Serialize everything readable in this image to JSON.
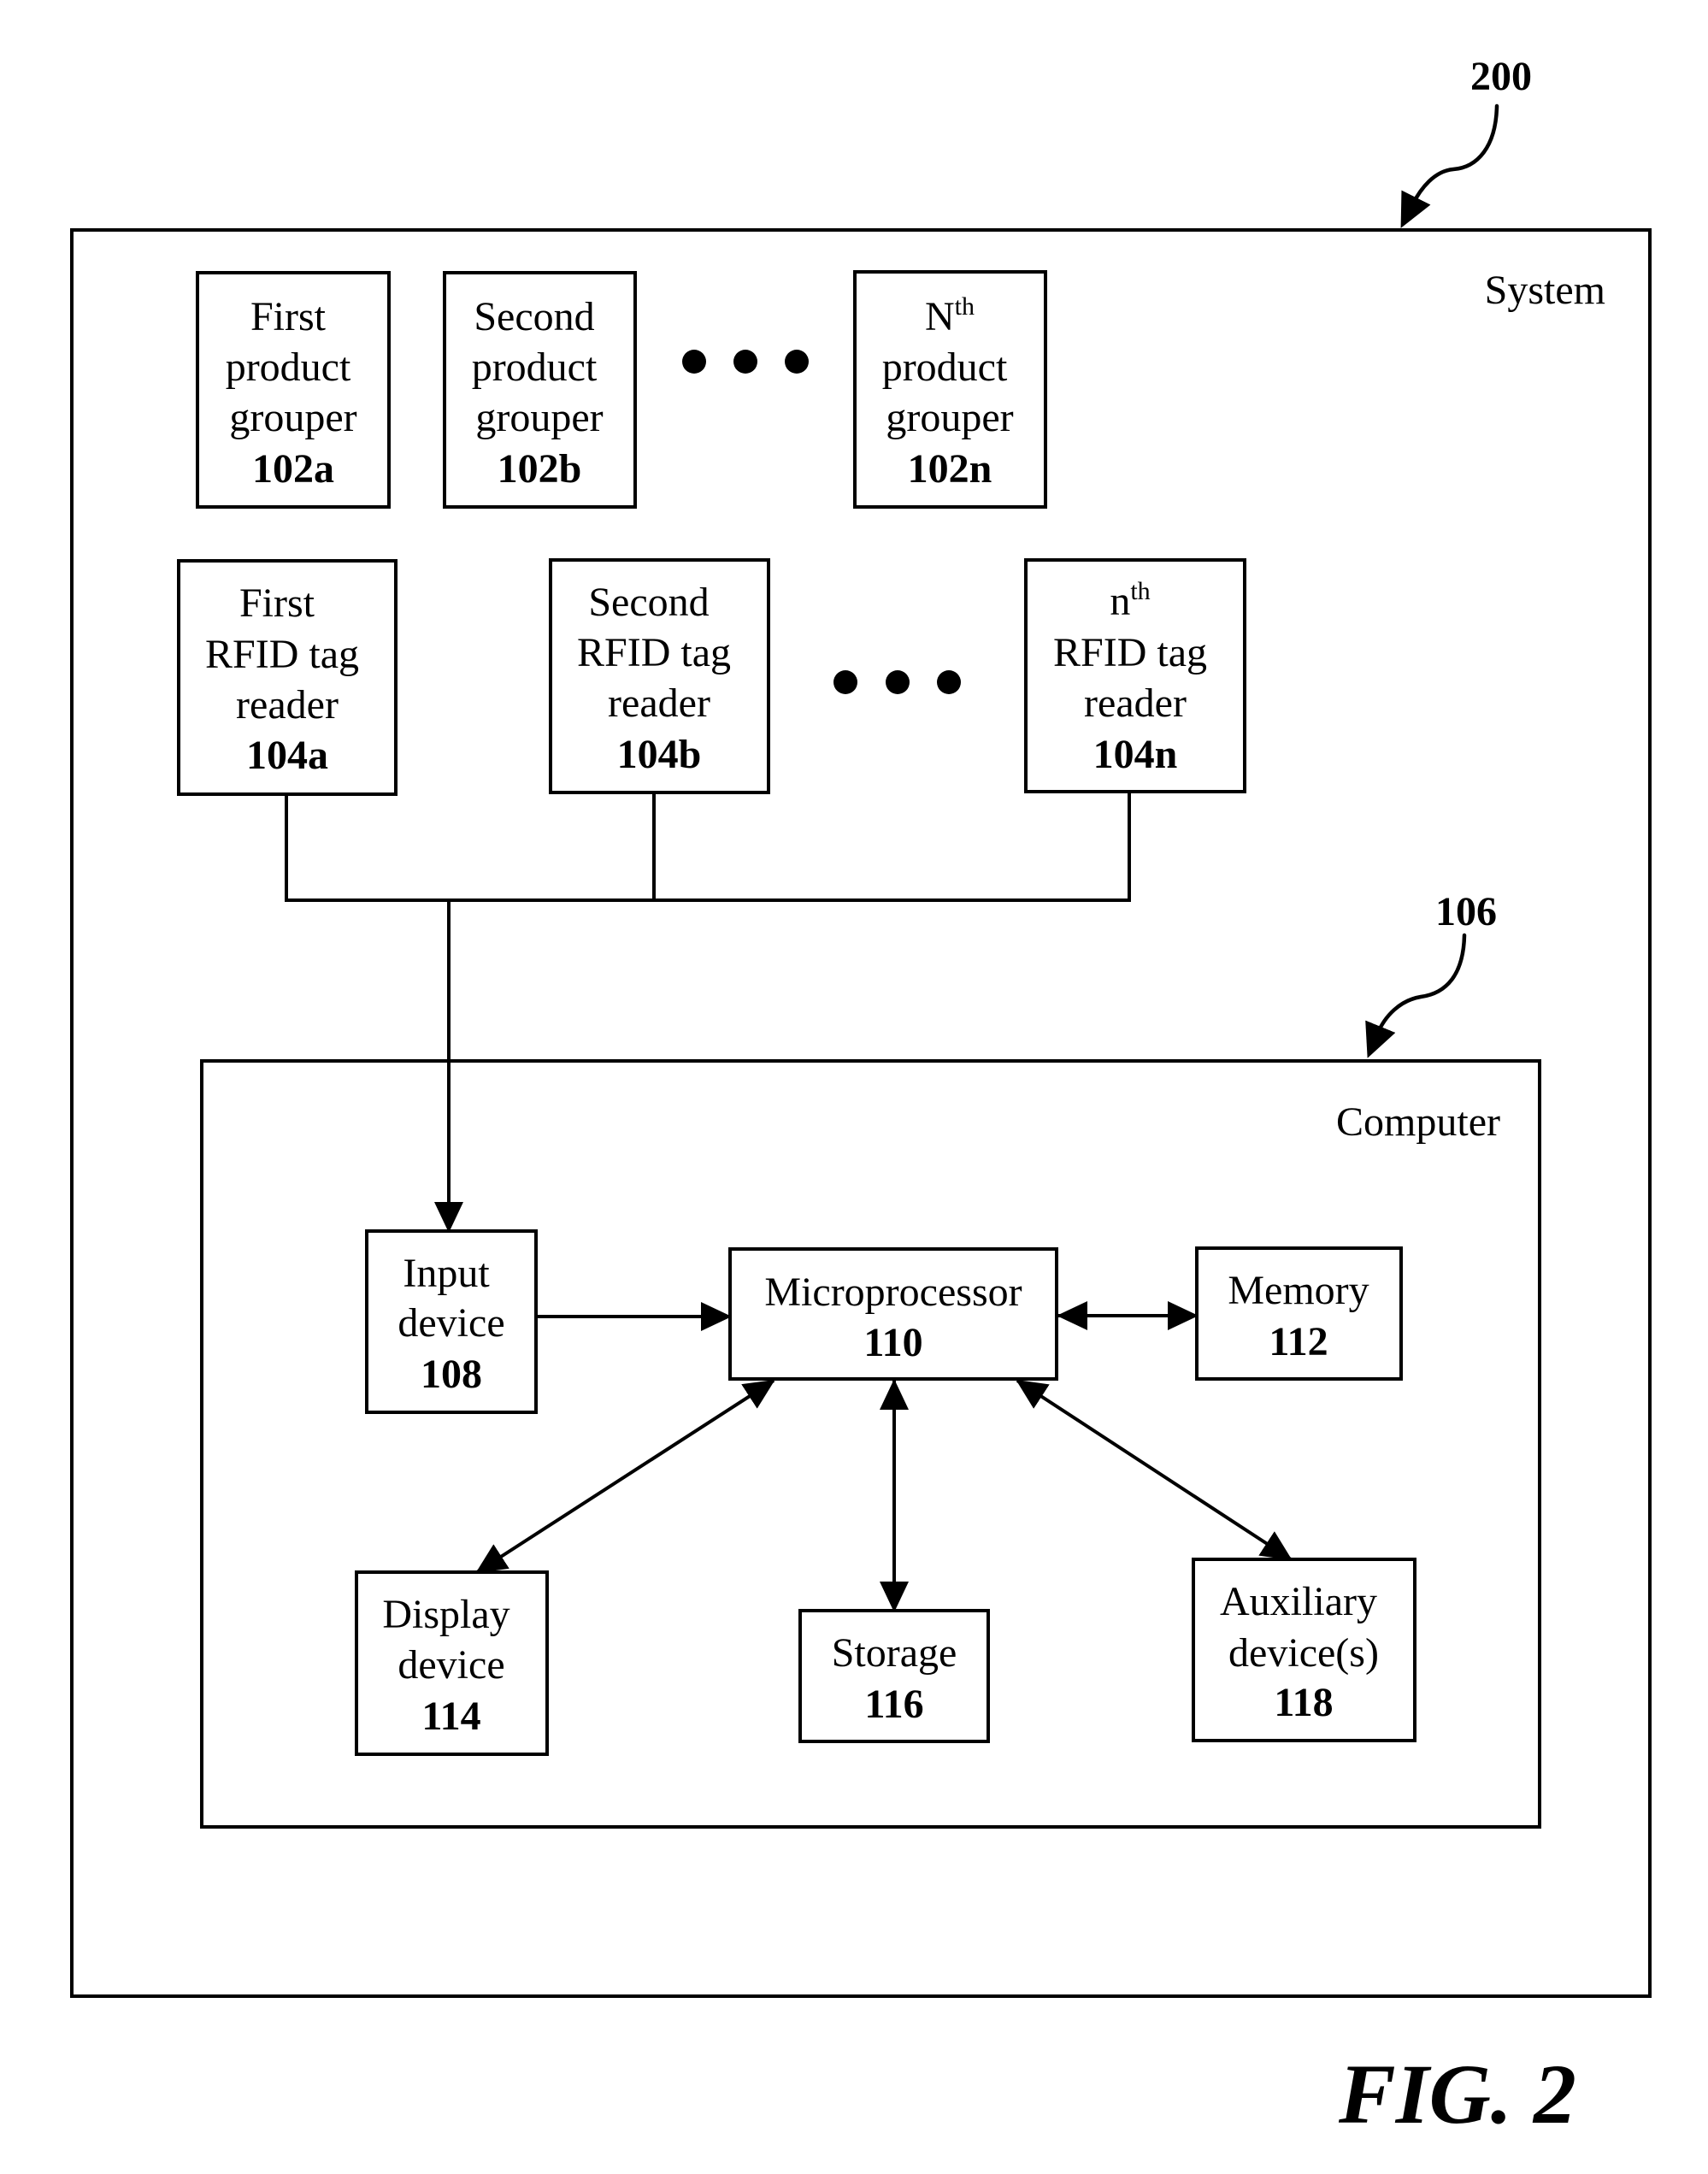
{
  "figure": {
    "caption": "FIG. 2",
    "system": {
      "ref": "200",
      "label": "System"
    },
    "computer": {
      "ref": "106",
      "label": "Computer"
    }
  },
  "groupers": [
    {
      "lines": [
        "First",
        "product",
        "grouper"
      ],
      "ref": "102a"
    },
    {
      "lines": [
        "Second",
        "product",
        "grouper"
      ],
      "ref": "102b"
    },
    {
      "first": {
        "base": "N",
        "sup": "th"
      },
      "lines": [
        "product",
        "grouper"
      ],
      "ref": "102n"
    }
  ],
  "readers": [
    {
      "lines": [
        "First",
        "RFID tag",
        "reader"
      ],
      "ref": "104a"
    },
    {
      "lines": [
        "Second",
        "RFID tag",
        "reader"
      ],
      "ref": "104b"
    },
    {
      "first": {
        "base": "n",
        "sup": "th"
      },
      "lines": [
        "RFID tag",
        "reader"
      ],
      "ref": "104n"
    }
  ],
  "computer_parts": {
    "input": {
      "lines": [
        "Input",
        "device"
      ],
      "ref": "108"
    },
    "microprocessor": {
      "lines": [
        "Microprocessor"
      ],
      "ref": "110"
    },
    "memory": {
      "lines": [
        "Memory"
      ],
      "ref": "112"
    },
    "display": {
      "lines": [
        "Display",
        "device"
      ],
      "ref": "114"
    },
    "storage": {
      "lines": [
        "Storage"
      ],
      "ref": "116"
    },
    "auxiliary": {
      "lines": [
        "Auxiliary",
        "device(s)"
      ],
      "ref": "118"
    }
  },
  "connections": [
    {
      "from": "104a",
      "to": "bus",
      "type": "line"
    },
    {
      "from": "104b",
      "to": "bus",
      "type": "line"
    },
    {
      "from": "104n",
      "to": "bus",
      "type": "line"
    },
    {
      "from": "bus",
      "to": "108",
      "type": "arrow"
    },
    {
      "from": "108",
      "to": "110",
      "type": "arrow"
    },
    {
      "from": "110",
      "to": "112",
      "type": "bidirectional"
    },
    {
      "from": "110",
      "to": "114",
      "type": "bidirectional"
    },
    {
      "from": "110",
      "to": "116",
      "type": "bidirectional"
    },
    {
      "from": "110",
      "to": "118",
      "type": "bidirectional"
    }
  ],
  "ellipsis": "• • •"
}
